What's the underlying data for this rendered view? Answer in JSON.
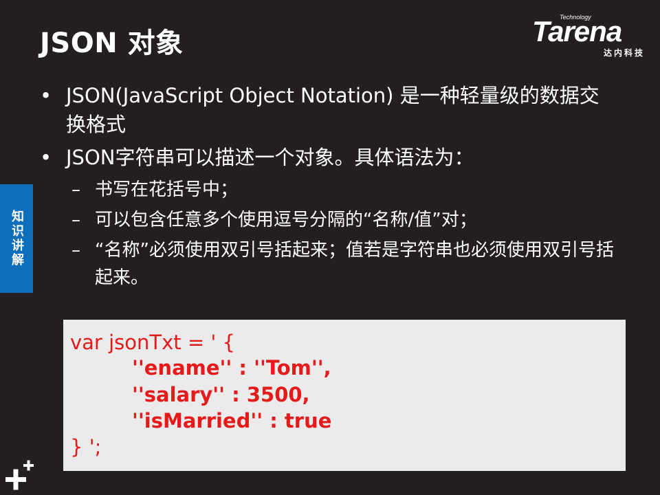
{
  "title": "JSON 对象",
  "logo": {
    "small": "Technology",
    "brand": "Tarena",
    "sub": "达内科技"
  },
  "side_tab": "知识讲解",
  "bullets": [
    {
      "marker": "•",
      "text": "JSON(JavaScript Object Notation) 是一种轻量级的数据交换格式"
    },
    {
      "marker": "•",
      "text": "JSON字符串可以描述一个对象。具体语法为："
    }
  ],
  "sub_items": [
    {
      "marker": "–",
      "text": "书写在花括号中；"
    },
    {
      "marker": "–",
      "text": "可以包含任意多个使用逗号分隔的“名称/值”对；"
    },
    {
      "marker": "–",
      "text": "“名称”必须使用双引号括起来；值若是字符串也必须使用双引号括起来。"
    }
  ],
  "code": {
    "lines": [
      "var jsonTxt = ' {",
      "''ename'' : ''Tom'',",
      "''salary'' : 3500,",
      "''isMarried'' : true",
      "} ';"
    ],
    "color": "#e51a1a",
    "background": "#ebebeb"
  },
  "colors": {
    "background": "#231f20",
    "side_tab": "#0f6eb9",
    "text": "#ffffff"
  },
  "icons": {
    "corner": "plus-icon"
  }
}
